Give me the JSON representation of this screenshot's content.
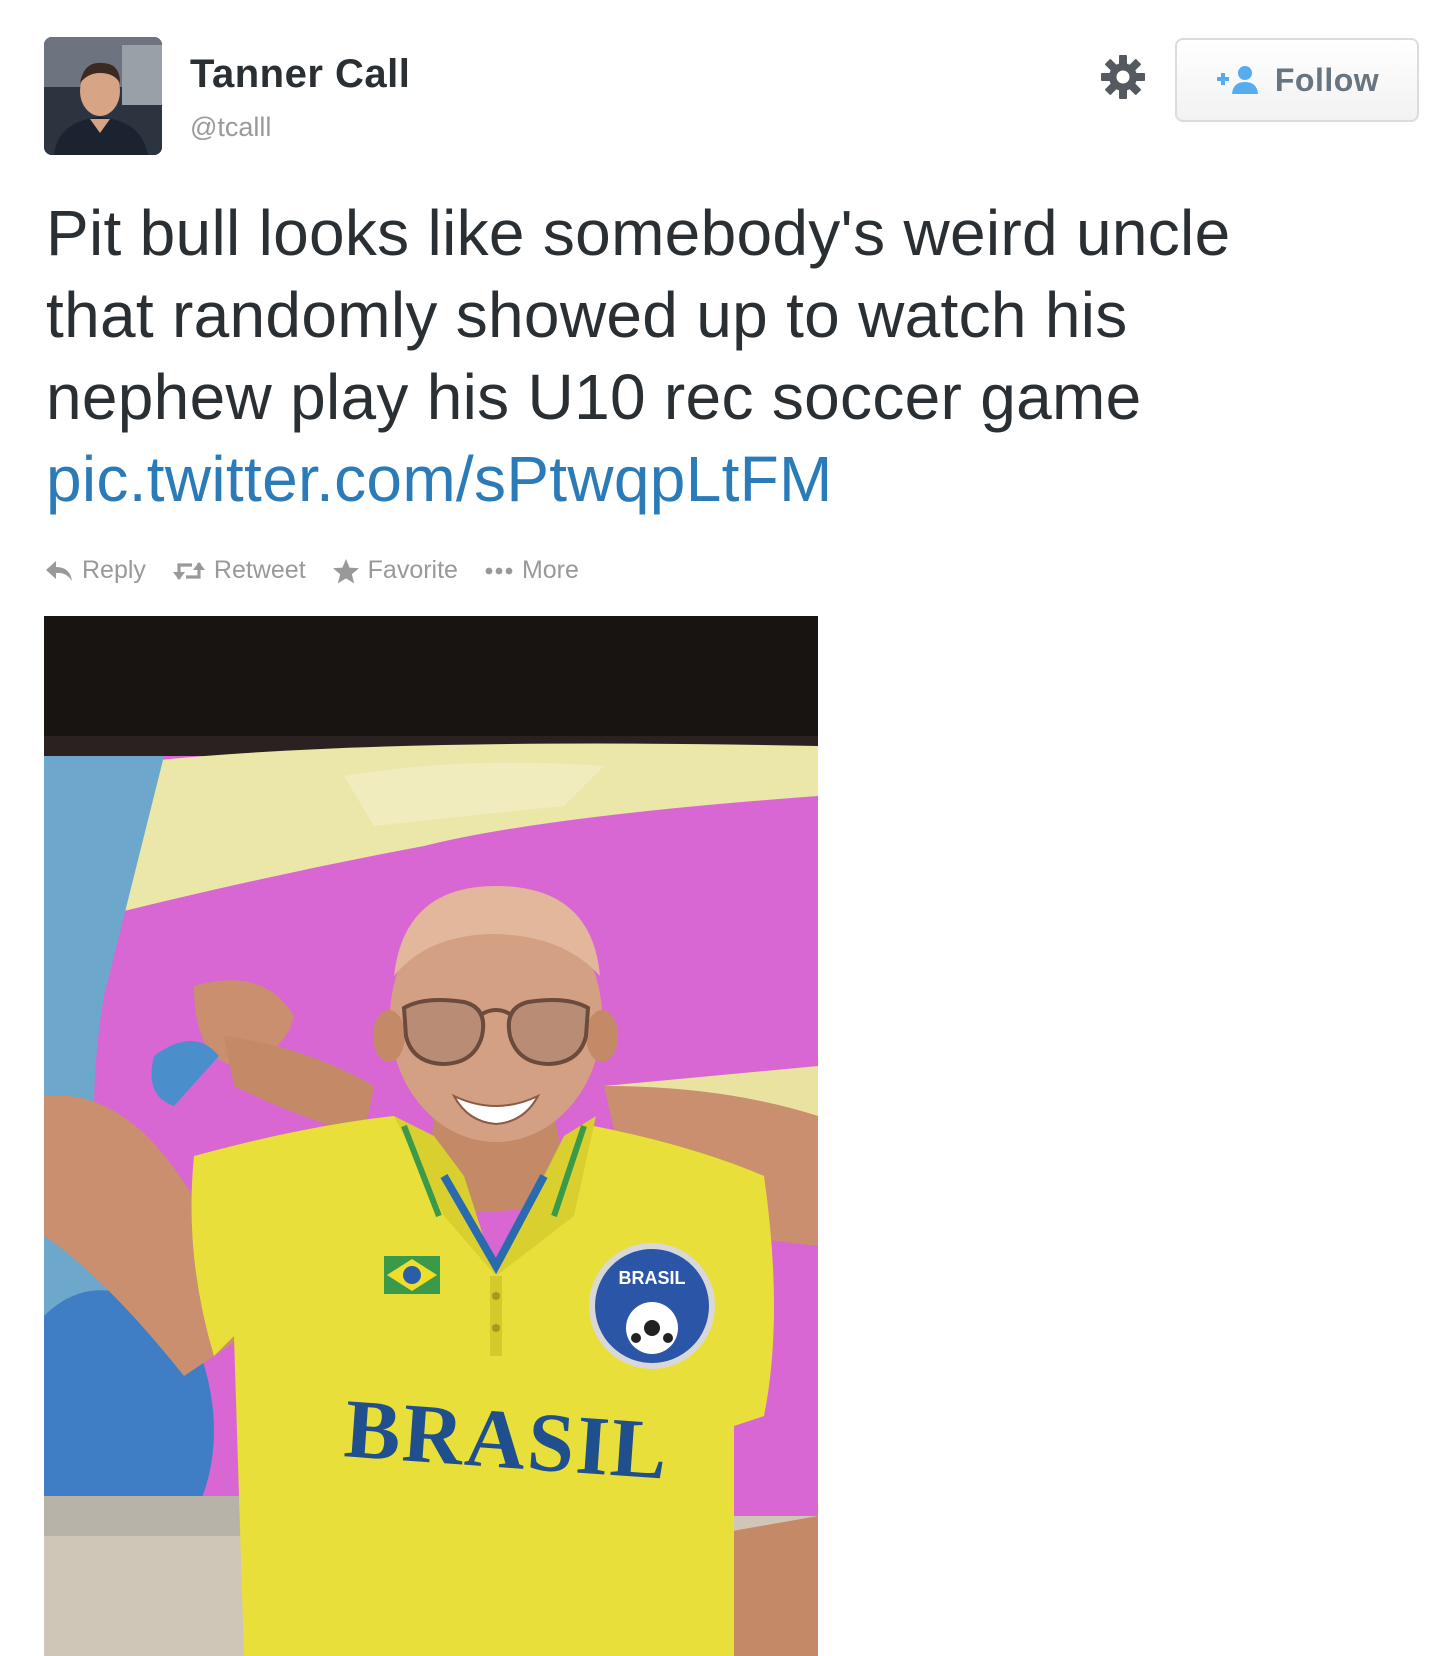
{
  "user": {
    "name": "Tanner Call",
    "handle": "@tcalll"
  },
  "follow": {
    "label": "Follow"
  },
  "tweet": {
    "lines": [
      "Pit bull looks like somebody's weird uncle",
      "that randomly showed up to watch his",
      "nephew play his U10 rec soccer game"
    ],
    "link": "pic.twitter.com/sPtwqpLtFM"
  },
  "actions": {
    "reply": "Reply",
    "retweet": "Retweet",
    "favorite": "Favorite",
    "more": "More"
  },
  "photo": {
    "shirt_text": "BRASIL",
    "badge_text": "BRASIL"
  },
  "colors": {
    "link": "#2b7bb9",
    "text": "#292f33",
    "muted": "#999999",
    "follow_icon": "#55acee",
    "shirt_yellow": "#e9df3a",
    "shirt_text": "#1f4f8c",
    "background_magenta": "#d867d3"
  },
  "icons": {
    "settings": "gear-icon",
    "follow": "add-user-icon",
    "reply": "reply-arrow-icon",
    "retweet": "retweet-icon",
    "favorite": "star-icon",
    "more": "ellipsis-icon"
  }
}
